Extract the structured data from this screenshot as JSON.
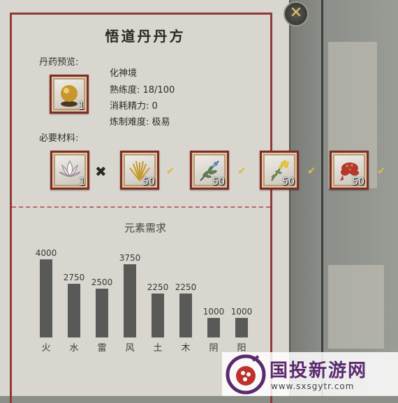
{
  "title": "悟道丹丹方",
  "preview_label": "丹药预览:",
  "pill": {
    "icon": "golden-pill-icon",
    "count": "1"
  },
  "info": {
    "realm": "化神境",
    "proficiency": "熟练度: 18/100",
    "energy_cost": "消耗精力: 0",
    "difficulty": "炼制难度: 极易"
  },
  "materials_label": "必要材料:",
  "materials": [
    {
      "icon": "lotus-icon",
      "count": "1",
      "check": ""
    },
    {
      "icon": "golden-grass-icon",
      "count": "50",
      "check": "✔"
    },
    {
      "icon": "blue-herb-icon",
      "count": "50",
      "check": "✔"
    },
    {
      "icon": "yellow-flower-icon",
      "count": "50",
      "check": "✔"
    },
    {
      "icon": "red-coral-icon",
      "count": "50",
      "check": "✔"
    }
  ],
  "times_symbol": "✖",
  "elements_title": "元素需求",
  "chart_data": {
    "type": "bar",
    "categories": [
      "火",
      "水",
      "雷",
      "风",
      "土",
      "木",
      "阴",
      "阳"
    ],
    "values": [
      4000,
      2750,
      2500,
      3750,
      2250,
      2250,
      1000,
      1000
    ],
    "bar_color": "#595957"
  },
  "close_icon": "close-icon",
  "watermark": {
    "text": "国投新游网",
    "url": "www.sxsgytr.com"
  }
}
